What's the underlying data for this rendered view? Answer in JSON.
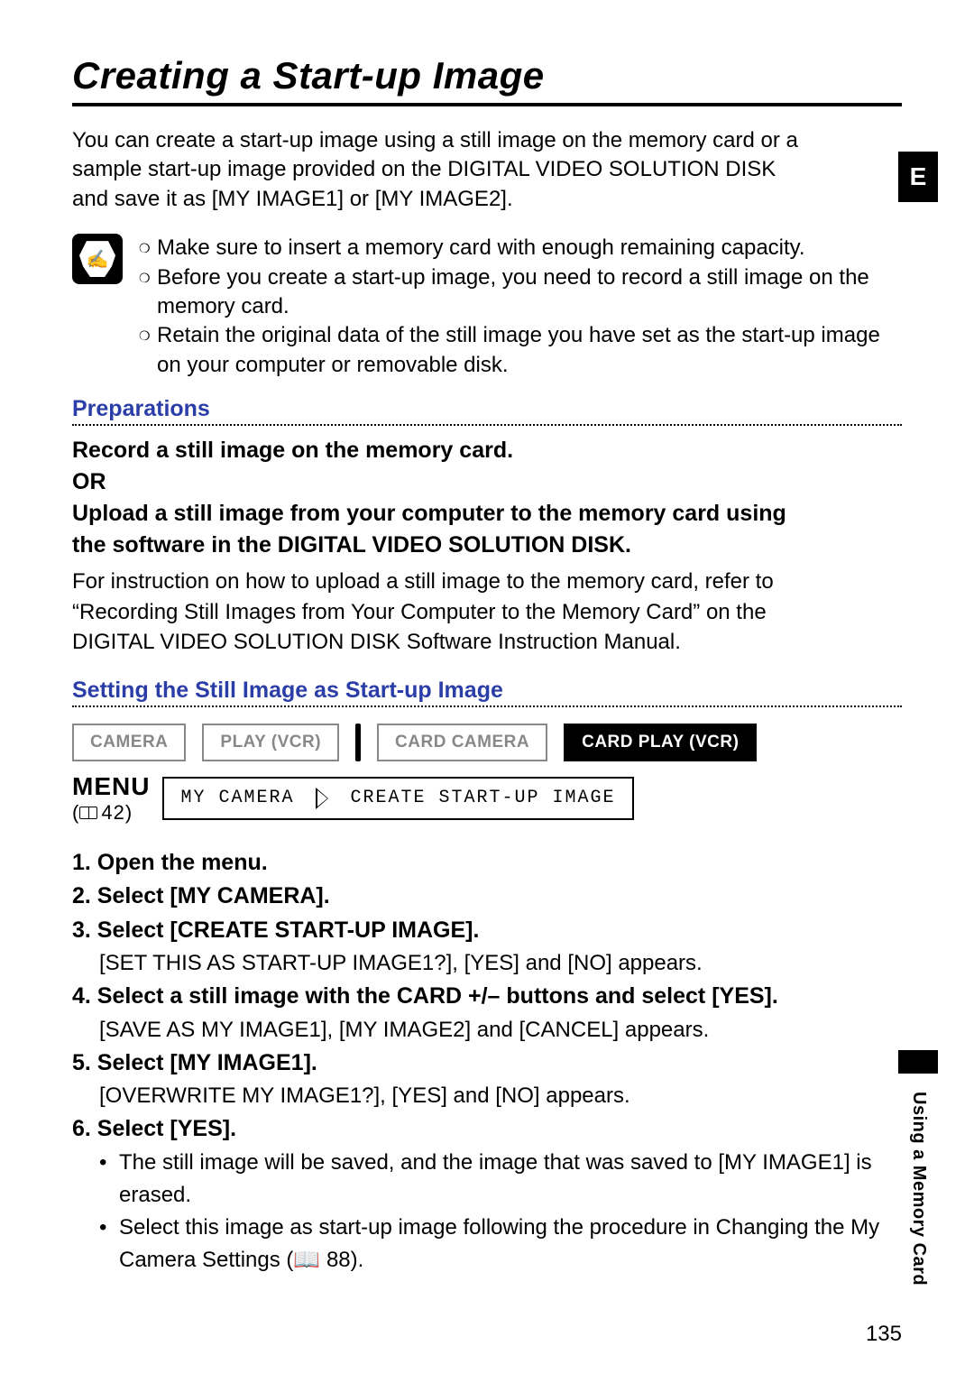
{
  "side_tab": "E",
  "title": "Creating a Start-up Image",
  "intro": "You can create a start-up image using a still image on the memory card or a sample start-up image provided on the DIGITAL VIDEO SOLUTION DISK and save it as [MY IMAGE1] or [MY IMAGE2].",
  "notes": [
    "Make sure to insert a memory card with enough remaining capacity.",
    "Before you create a start-up image, you need to record a still image on the memory card.",
    "Retain the original data of the still image you have set as the start-up image on your computer or removable disk."
  ],
  "preparations_heading": "Preparations",
  "prep_line1": "Record a still image on the memory card.",
  "prep_or": "OR",
  "prep_line2": "Upload a still image from your computer to the memory card using the software in the DIGITAL VIDEO SOLUTION DISK.",
  "prep_detail_a": "For instruction on how to upload a still image to the memory card, refer to “Recording Still Images from Your Computer to the Memory Card” on the DIGITAL VIDEO SOLUTION DISK Software Instruction Manual.",
  "setting_heading": "Setting the Still Image as Start-up Image",
  "modes": {
    "camera": "CAMERA",
    "play_vcr": "PLAY (VCR)",
    "card_camera": "CARD CAMERA",
    "card_play_vcr": "CARD PLAY (VCR)"
  },
  "menu": {
    "label": "MENU",
    "ref": "42",
    "path_a": "MY CAMERA",
    "path_b": "CREATE START-UP IMAGE"
  },
  "steps": [
    {
      "t": "1. Open the menu."
    },
    {
      "t": "2. Select [MY CAMERA]."
    },
    {
      "t": "3. Select [CREATE START-UP IMAGE].",
      "d": "[SET THIS AS START-UP IMAGE1?], [YES] and [NO] appears."
    },
    {
      "t": "4. Select a still image with the CARD +/– buttons and select [YES].",
      "d": "[SAVE AS MY IMAGE1], [MY IMAGE2] and [CANCEL] appears."
    },
    {
      "t": "5. Select [MY IMAGE1].",
      "d": "[OVERWRITE MY IMAGE1?], [YES] and [NO] appears."
    },
    {
      "t": "6. Select [YES].",
      "subs": [
        "The still image will be saved, and the image that was saved to [MY IMAGE1] is erased.",
        "Select this image as start-up image following the procedure in Changing the My Camera Settings (📖 88)."
      ]
    }
  ],
  "vside": "Using a Memory Card",
  "page_number": "135"
}
